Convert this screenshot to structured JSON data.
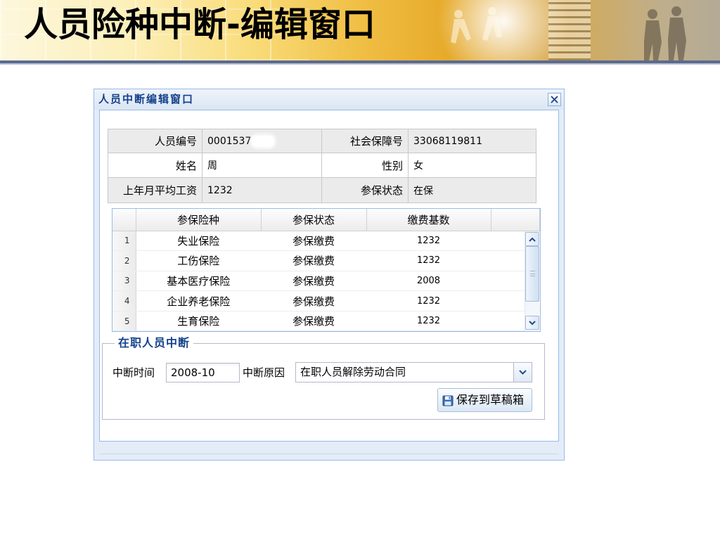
{
  "slide": {
    "title": "人员险种中断-编辑窗口"
  },
  "colors": {
    "accent": "#15428b",
    "window_border": "#99bbe8",
    "window_bg": "#e4ecf7",
    "info_row_shaded": "#ebebeb",
    "banner_gold": "#e7aa2a"
  },
  "window": {
    "title": "人员中断编辑窗口",
    "close_icon": "close-icon",
    "info": {
      "rows": [
        [
          {
            "label": "人员编号",
            "value": "0001537"
          },
          {
            "label": "社会保障号",
            "value": "33068119811"
          }
        ],
        [
          {
            "label": "姓名",
            "value": "周"
          },
          {
            "label": "性别",
            "value": "女"
          }
        ],
        [
          {
            "label": "上年月平均工资",
            "value": "1232"
          },
          {
            "label": "参保状态",
            "value": "在保"
          }
        ]
      ]
    },
    "grid": {
      "columns": [
        "参保险种",
        "参保状态",
        "缴费基数"
      ],
      "rows": [
        {
          "no": "1",
          "insurance": "失业保险",
          "status": "参保缴费",
          "base": "1232"
        },
        {
          "no": "2",
          "insurance": "工伤保险",
          "status": "参保缴费",
          "base": "1232"
        },
        {
          "no": "3",
          "insurance": "基本医疗保险",
          "status": "参保缴费",
          "base": "2008"
        },
        {
          "no": "4",
          "insurance": "企业养老保险",
          "status": "参保缴费",
          "base": "1232"
        },
        {
          "no": "5",
          "insurance": "生育保险",
          "status": "参保缴费",
          "base": "1232"
        }
      ],
      "scroll_up_icon": "chevron-up-icon",
      "scroll_down_icon": "chevron-down-icon"
    },
    "interruption": {
      "legend": "在职人员中断",
      "time_label": "中断时间",
      "time_value": "2008-10",
      "reason_label": "中断原因",
      "reason_value": "在职人员解除劳动合同",
      "reason_dropdown_icon": "chevron-down-icon",
      "save_label": "保存到草稿箱",
      "save_icon": "floppy-disk-icon"
    }
  }
}
